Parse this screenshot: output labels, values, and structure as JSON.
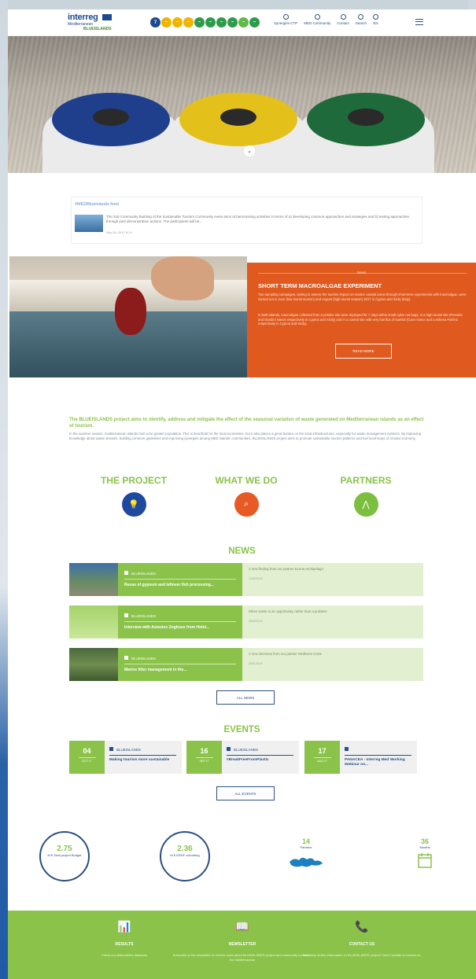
{
  "header": {
    "logo_main": "interreg",
    "logo_sub": "Mediterranean",
    "logo_project": "BLUEISLANDS",
    "goals": [
      {
        "label": "7",
        "color": "#1d4a8f"
      },
      {
        "label": "~",
        "color": "#f0b400"
      },
      {
        "label": "~",
        "color": "#f0b400"
      },
      {
        "label": "~",
        "color": "#f0b400"
      },
      {
        "label": "~",
        "color": "#2e9b4a"
      },
      {
        "label": "~",
        "color": "#2e9b4a"
      },
      {
        "label": "~",
        "color": "#2e9b4a"
      },
      {
        "label": "~",
        "color": "#2e9b4a"
      },
      {
        "label": "~",
        "color": "#5fba46"
      },
      {
        "label": "~",
        "color": "#2e9b4a"
      }
    ],
    "nav": [
      "Synergies CTP",
      "MED Community",
      "Contact",
      "Search",
      "EN"
    ]
  },
  "feed": {
    "title": "#MEDBlueIslands feed",
    "text": "The 2nd Community Building of the Sustainable Tourism Community event aims at harmonising activities in terms of a) developing common approaches and strategies and b) testing approaches through joint demonstration actions. The participants will be...",
    "date": "Sep 26, 2017 8:14"
  },
  "experiment": {
    "tag": "News",
    "title": "SHORT TERM MACROALGAE EXPERIMENT",
    "p1": "Two sampling campaigns, aiming to assess the tourism impact on marine coastal areas through short-term experiments with macroalgae, were carried out in June (low tourist season) and August (high tourist season) 2017 in Cyprus and Sicily (Italy).",
    "p2": "In both islands, macroalgae collected from a pristine site were deployed for 7 days within small nylon net bags, in a high tourist site (Pervolia and Giardini Naxos respectively in Cyprus and Sicily) and in a control site with very low flux of tourists (Cavo Greco and Lombesa Parrino respectively in Cyprus and Sicily).",
    "button": "READ MORE"
  },
  "intro": {
    "heading": "The BLUEISLANDS project aims to identify, address and mitigate the effect of the seasonal variation of waste generated on Mediterranean islands as an effect of tourism.",
    "body": "In the summer season, mediterranean islands host a far greater population. This is beneficial for the local economies, but it also places a great burden on the local infrastructures, especially for waste management systems. By improving knowledge about waste streams, building common guidelines and improving synergies among MED islands' communities, BLUEISLANDS project aims to promote sustainable tourism patterns and fuel local loops of circular economy."
  },
  "pillars": [
    {
      "label": "THE PROJECT",
      "icon": "lightbulb-icon",
      "color": "#1d4a9f",
      "glyph": "💡"
    },
    {
      "label": "WHAT WE DO",
      "icon": "magnifier-icon",
      "color": "#e85a24",
      "glyph": "⌕"
    },
    {
      "label": "PARTNERS",
      "icon": "share-icon",
      "color": "#7cbf3f",
      "glyph": "⋀"
    }
  ],
  "news": {
    "title": "NEWS",
    "items": [
      {
        "cat": "BLUEISLANDS",
        "title": "Reuse of gypsum and leftover fish processing...",
        "excerpt": "A new finding from our partner ELena Archipelago",
        "date": "12/02/2019",
        "img": "linear-gradient(180deg,#3f6fa8,#6a8d62 60%,#8c8a78)"
      },
      {
        "cat": "BLUEISLANDS",
        "title": "Interview with Asteeios Zoghous from Hotel...",
        "excerpt": "When waste is an opportunity, rather than a problem",
        "date": "05/02/2019",
        "img": "linear-gradient(180deg,#a5d36a,#c9e79a)"
      },
      {
        "cat": "BLUEISLANDS",
        "title": "Marine litter management in the...",
        "excerpt": "A new interview from our partner Mediterrn Crete",
        "date": "28/01/2019",
        "img": "linear-gradient(180deg,#4b6a3d,#6f8d4f 50%,#3e5a2f)"
      }
    ],
    "all_button": "ALL NEWS"
  },
  "events": {
    "title": "EVENTS",
    "items": [
      {
        "day": "04",
        "month": "OCT 17",
        "cat": "BLUEISLANDS",
        "title": "Making tourism more sustainable"
      },
      {
        "day": "16",
        "month": "SEP 17",
        "cat": "BLUEISLANDS",
        "title": "#BreakFreeFromPlastic"
      },
      {
        "day": "17",
        "month": "AUG 17",
        "cat": "",
        "title": "PANACEA - Interreg Med Working Webinar on..."
      }
    ],
    "all_button": "ALL EVENTS"
  },
  "stats": [
    {
      "value": "2.75",
      "label": "M € Total project Budget"
    },
    {
      "value": "2.36",
      "label": "M € ERDF cofunding"
    },
    {
      "value": "14",
      "label": "Partners"
    },
    {
      "value": "36",
      "label": "Months"
    }
  ],
  "footer": [
    {
      "icon": "chart-icon",
      "glyph": "📊",
      "title": "RESULTS",
      "text": "Check our deliverables database"
    },
    {
      "icon": "newspaper-icon",
      "glyph": "📖",
      "title": "NEWSLETTER",
      "text": "Subscribe to the newsletter to receive news about BLUEISLANDS project and community content in the Mediterranean"
    },
    {
      "icon": "phone-icon",
      "glyph": "📞",
      "title": "CONTACT US",
      "text": "Need any further information on BLUEISLANDS project? Don't hesitate to contact us."
    }
  ]
}
